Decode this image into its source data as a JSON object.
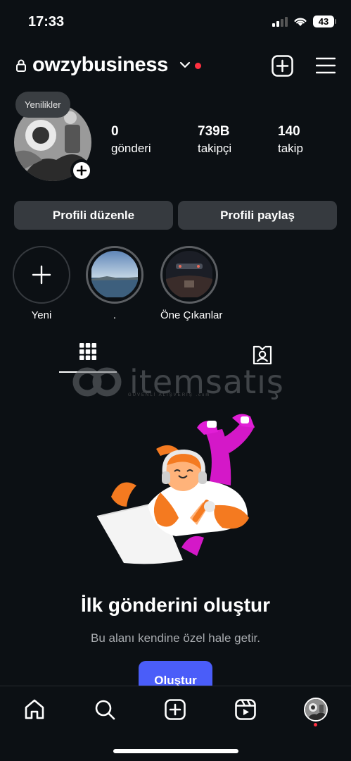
{
  "status_bar": {
    "time": "17:33",
    "battery": "43"
  },
  "header": {
    "username": "owzybusiness"
  },
  "profile": {
    "news_bubble": "Yenilikler"
  },
  "stats": [
    {
      "value": "0",
      "label": "gönderi"
    },
    {
      "value": "739B",
      "label": "takipçi"
    },
    {
      "value": "140",
      "label": "takip"
    }
  ],
  "buttons": {
    "edit_profile": "Profili düzenle",
    "share_profile": "Profili paylaş"
  },
  "highlights": [
    {
      "label": "Yeni"
    },
    {
      "label": "."
    },
    {
      "label": "Öne Çıkanlar"
    }
  ],
  "watermark": {
    "text": "itemsatış",
    "sub": "GÜVENLİ ALIŞVERİŞ .com"
  },
  "empty_state": {
    "title": "İlk gönderini oluştur",
    "subtitle": "Bu alanı kendine özel hale getir.",
    "button": "Oluştur"
  },
  "tabbar_icons": [
    "home-icon",
    "search-icon",
    "create-icon",
    "reels-icon",
    "profile-avatar"
  ],
  "colors": {
    "background": "#0c1014",
    "button": "#363a3f",
    "accent": "#4a5df9",
    "notification": "#ff3040"
  }
}
